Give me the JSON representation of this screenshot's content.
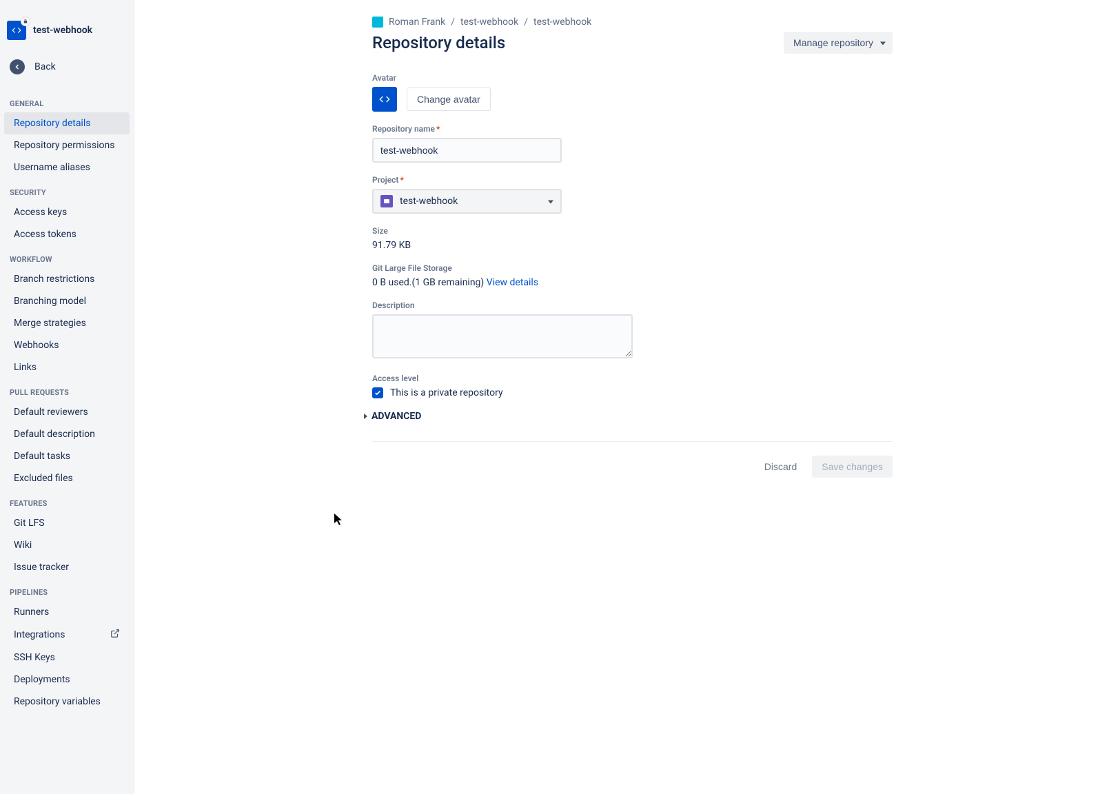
{
  "sidebar": {
    "repo_title": "test-webhook",
    "back_label": "Back",
    "sections": [
      {
        "title": "GENERAL",
        "items": [
          "Repository details",
          "Repository permissions",
          "Username aliases"
        ]
      },
      {
        "title": "SECURITY",
        "items": [
          "Access keys",
          "Access tokens"
        ]
      },
      {
        "title": "WORKFLOW",
        "items": [
          "Branch restrictions",
          "Branching model",
          "Merge strategies",
          "Webhooks",
          "Links"
        ]
      },
      {
        "title": "PULL REQUESTS",
        "items": [
          "Default reviewers",
          "Default description",
          "Default tasks",
          "Excluded files"
        ]
      },
      {
        "title": "FEATURES",
        "items": [
          "Git LFS",
          "Wiki",
          "Issue tracker"
        ]
      },
      {
        "title": "PIPELINES",
        "items": [
          "Runners",
          "Integrations",
          "SSH Keys",
          "Deployments",
          "Repository variables"
        ]
      }
    ]
  },
  "breadcrumb": {
    "owner": "Roman Frank",
    "project": "test-webhook",
    "repo": "test-webhook"
  },
  "header": {
    "title": "Repository details",
    "manage_label": "Manage repository"
  },
  "form": {
    "avatar_label": "Avatar",
    "change_avatar": "Change avatar",
    "repo_name_label": "Repository name",
    "repo_name_value": "test-webhook",
    "project_label": "Project",
    "project_value": "test-webhook",
    "size_label": "Size",
    "size_value": "91.79 KB",
    "lfs_label": "Git Large File Storage",
    "lfs_value": "0 B used.(1 GB remaining)",
    "lfs_link": "View details",
    "description_label": "Description",
    "description_value": "",
    "access_label": "Access level",
    "access_checkbox": "This is a private repository",
    "advanced_label": "ADVANCED"
  },
  "footer": {
    "discard": "Discard",
    "save": "Save changes"
  }
}
